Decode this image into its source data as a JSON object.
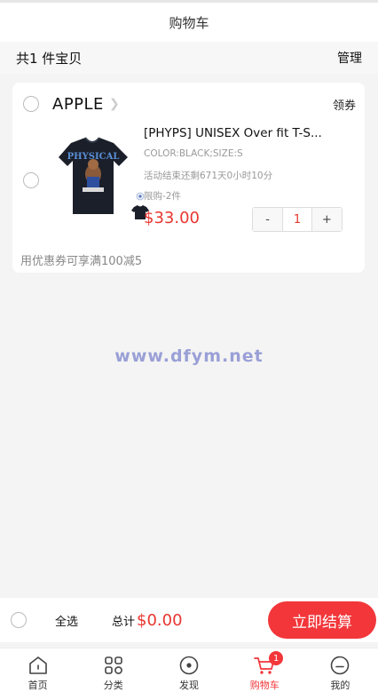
{
  "header": {
    "title": "购物车"
  },
  "summary": {
    "count_text": "共1 件宝贝",
    "manage_label": "管理"
  },
  "store": {
    "name": "APPLE",
    "coupon_label": "领券",
    "item": {
      "title": "[PHYPS] UNISEX Over fit T-S...",
      "spec": "COLOR:BLACK;SIZE:S",
      "timer": "活动结束还剩671天0小时10分",
      "limit": "限购-2件",
      "price": "$33.00",
      "quantity": "1",
      "minus_label": "-",
      "plus_label": "+",
      "shirt_print": "PHYSICAL"
    },
    "promo": "用优惠券可享满100减5"
  },
  "watermark": "www.dfym.net",
  "checkout": {
    "select_all_label": "全选",
    "total_label": "总计",
    "total_value": "$0.00",
    "pay_label": "立即结算"
  },
  "tabbar": {
    "items": [
      {
        "label": "首页",
        "icon": "home-icon"
      },
      {
        "label": "分类",
        "icon": "category-icon"
      },
      {
        "label": "发现",
        "icon": "discover-icon"
      },
      {
        "label": "购物车",
        "icon": "cart-icon",
        "badge": "1",
        "active": true
      },
      {
        "label": "我的",
        "icon": "profile-icon"
      }
    ]
  },
  "colors": {
    "accent": "#f2363a",
    "price": "#e8362f"
  }
}
